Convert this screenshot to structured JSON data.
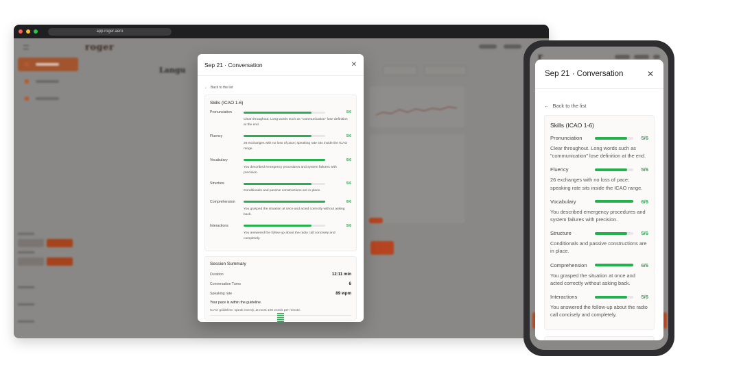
{
  "browser": {
    "url": "app.roger.aero"
  },
  "background_app": {
    "logo": "roger"
  },
  "modal": {
    "title": "Sep 21 · Conversation",
    "back_label": "Back to the list",
    "skills_title": "Skills (ICAO 1-6)",
    "skills": [
      {
        "name": "Pronunciation",
        "score": "5/6",
        "level": 5,
        "max": 6,
        "description": "Clear throughout. Long words such as \"communication\" lose definition at the end."
      },
      {
        "name": "Fluency",
        "score": "5/6",
        "level": 5,
        "max": 6,
        "description": "26 exchanges with no loss of pace; speaking rate sits inside the ICAO range."
      },
      {
        "name": "Vocabulary",
        "score": "6/6",
        "level": 6,
        "max": 6,
        "description": "You described emergency procedures and system failures with precision."
      },
      {
        "name": "Structure",
        "score": "5/6",
        "level": 5,
        "max": 6,
        "description": "Conditionals and passive constructions are in place."
      },
      {
        "name": "Comprehension",
        "score": "6/6",
        "level": 6,
        "max": 6,
        "description": "You grasped the situation at once and acted correctly without asking back."
      },
      {
        "name": "Interactions",
        "score": "5/6",
        "level": 5,
        "max": 6,
        "description": "You answered the follow-up about the radio call concisely and completely."
      }
    ],
    "summary_title": "Session Summary",
    "summary": [
      {
        "label": "Duration",
        "value": "12:11 min"
      },
      {
        "label": "Conversation Turns",
        "value": "6"
      },
      {
        "label": "Speaking rate",
        "value": "89 wpm"
      }
    ],
    "pace_note": "Your pace is within the guideline.",
    "guideline": "ICAO guideline: speak evenly, at most 100 words per minute."
  },
  "icons": {
    "close": "close-icon",
    "back": "arrow-left-icon",
    "spinner": "loading-icon"
  },
  "colors": {
    "success": "#22b14c",
    "brand": "#b54520"
  }
}
